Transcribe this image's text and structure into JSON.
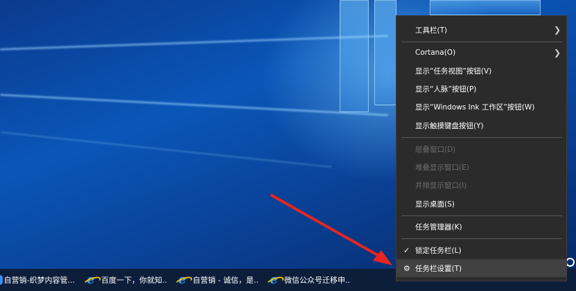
{
  "taskbar": {
    "items": [
      {
        "label": "自营销-织梦内容管...",
        "icon": "browser-icon"
      },
      {
        "label": "百度一下，你就知...",
        "icon": "ie-icon"
      },
      {
        "label": "自营销 - 诚信，是...",
        "icon": "ie-icon"
      },
      {
        "label": "微信公众号迁移申...",
        "icon": "ie-icon"
      }
    ]
  },
  "context_menu": {
    "items": [
      {
        "label": "工具栏(T)",
        "submenu": true
      },
      {
        "label": "Cortana(O)",
        "submenu": true
      },
      {
        "label": "显示“任务视图”按钮(V)"
      },
      {
        "label": "显示“人脉”按钮(P)"
      },
      {
        "label": "显示“Windows Ink 工作区”按钮(W)"
      },
      {
        "label": "显示触摸键盘按钮(Y)"
      },
      {
        "label": "层叠窗口(D)",
        "disabled": true
      },
      {
        "label": "堆叠显示窗口(E)",
        "disabled": true
      },
      {
        "label": "并排显示窗口(I)",
        "disabled": true
      },
      {
        "label": "显示桌面(S)"
      },
      {
        "label": "任务管理器(K)"
      },
      {
        "label": "锁定任务栏(L)",
        "checked": true
      },
      {
        "label": "任务栏设置(T)",
        "icon": "gear-icon",
        "hover": true
      }
    ]
  },
  "colors": {
    "menu_bg": "#2b2b2b",
    "menu_hover": "#414141",
    "taskbar_bg": "#0d1e3a",
    "annotation_arrow": "#e8251f"
  }
}
